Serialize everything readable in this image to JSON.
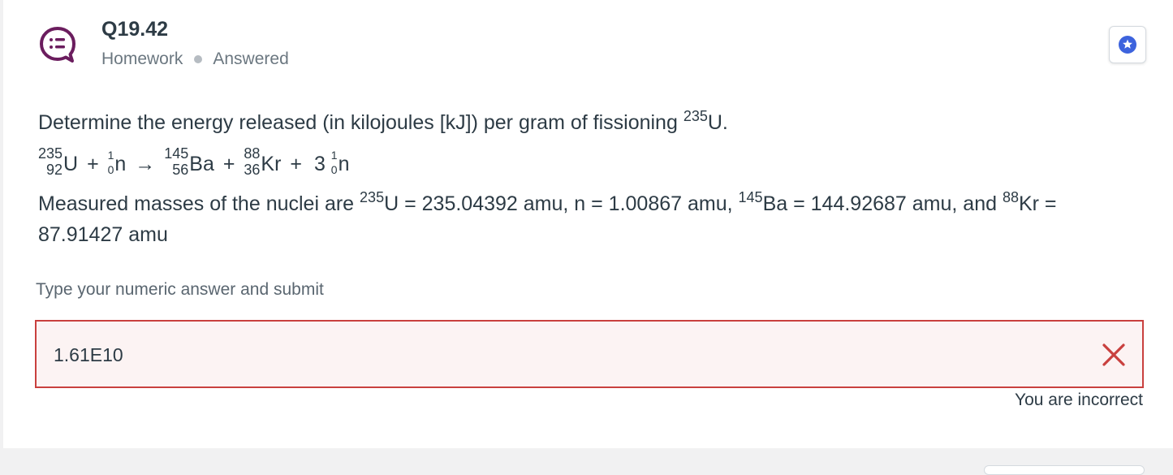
{
  "question": {
    "title": "Q19.42",
    "category": "Homework",
    "status": "Answered"
  },
  "body": {
    "line1_text": "Determine the energy released (in kilojoules [kJ]) per gram of fissioning ",
    "line1_iso": "235",
    "line1_sym": "U.",
    "equation": {
      "u_mass": "235",
      "u_z": "92",
      "u_sym": "U",
      "plus": "+",
      "n_mass": "1",
      "n_z": "0",
      "n_sym": "n",
      "arrow": "→",
      "ba_mass": "145",
      "ba_z": "56",
      "ba_sym": "Ba",
      "kr_mass": "88",
      "kr_z": "36",
      "kr_sym": "Kr",
      "coef": "3",
      "n2_mass": "1",
      "n2_z": "0",
      "n2_sym": "n"
    },
    "masses": {
      "intro": "Measured masses of the nuclei are ",
      "u_iso": "235",
      "u_text": "U = 235.04392 amu, n = 1.00867 amu, ",
      "ba_iso": "145",
      "ba_text": "Ba = 144.92687 amu, and ",
      "kr_iso": "88",
      "kr_text": "Kr = 87.91427 amu"
    }
  },
  "answer": {
    "prompt": "Type your numeric answer and submit",
    "value": "1.61E10",
    "result": "You are incorrect"
  },
  "icons": {
    "question": "chat-list-icon",
    "star": "star-icon",
    "incorrect": "x-icon"
  },
  "colors": {
    "accent_purple": "#6b1d5e",
    "star_blue": "#3d63dd",
    "error_red": "#c9403e",
    "error_bg": "#fcf3f3"
  }
}
